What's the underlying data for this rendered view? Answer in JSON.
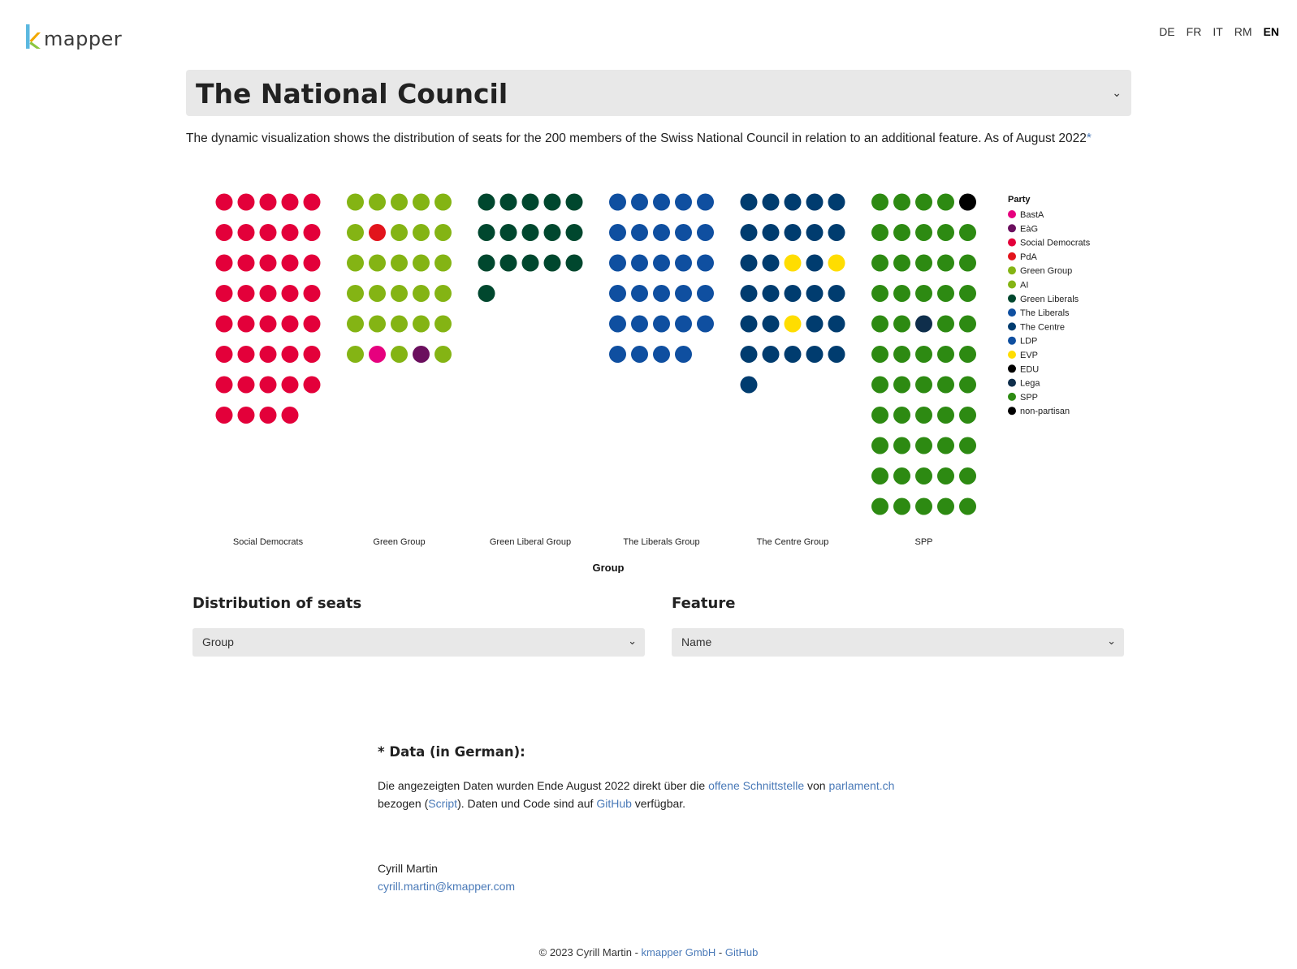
{
  "header": {
    "logo_text": "mapper",
    "languages": [
      "DE",
      "FR",
      "IT",
      "RM",
      "EN"
    ],
    "active_language": "EN"
  },
  "title_select": {
    "value": "The National Council"
  },
  "intro": {
    "text": "The dynamic visualization shows the distribution of seats for the 200 members of the Swiss National Council in relation to an additional feature. As of August 2022",
    "star": "*"
  },
  "chart_data": {
    "type": "dot_grid",
    "xlabel": "Group",
    "columns_per_group": 5,
    "groups": [
      {
        "name": "Social Democrats",
        "seats": [
          "Social Democrats",
          "Social Democrats",
          "Social Democrats",
          "Social Democrats",
          "Social Democrats",
          "Social Democrats",
          "Social Democrats",
          "Social Democrats",
          "Social Democrats",
          "Social Democrats",
          "Social Democrats",
          "Social Democrats",
          "Social Democrats",
          "Social Democrats",
          "Social Democrats",
          "Social Democrats",
          "Social Democrats",
          "Social Democrats",
          "Social Democrats",
          "Social Democrats",
          "Social Democrats",
          "Social Democrats",
          "Social Democrats",
          "Social Democrats",
          "Social Democrats",
          "Social Democrats",
          "Social Democrats",
          "Social Democrats",
          "Social Democrats",
          "Social Democrats",
          "Social Democrats",
          "Social Democrats",
          "Social Democrats",
          "Social Democrats",
          "Social Democrats",
          "Social Democrats",
          "Social Democrats",
          "Social Democrats",
          "Social Democrats"
        ]
      },
      {
        "name": "Green Group",
        "seats": [
          "Green Group",
          "Green Group",
          "Green Group",
          "Green Group",
          "Green Group",
          "Green Group",
          "PdA",
          "Green Group",
          "Green Group",
          "Green Group",
          "Green Group",
          "Green Group",
          "Green Group",
          "Green Group",
          "Green Group",
          "Green Group",
          "Green Group",
          "Green Group",
          "Green Group",
          "Green Group",
          "Green Group",
          "Green Group",
          "Green Group",
          "Green Group",
          "Green Group",
          "AI",
          "BastA",
          "AI",
          "EàG",
          "AI"
        ]
      },
      {
        "name": "Green Liberal Group",
        "seats": [
          "Green Liberals",
          "Green Liberals",
          "Green Liberals",
          "Green Liberals",
          "Green Liberals",
          "Green Liberals",
          "Green Liberals",
          "Green Liberals",
          "Green Liberals",
          "Green Liberals",
          "Green Liberals",
          "Green Liberals",
          "Green Liberals",
          "Green Liberals",
          "Green Liberals",
          "Green Liberals"
        ]
      },
      {
        "name": "The Liberals Group",
        "seats": [
          "The Liberals",
          "The Liberals",
          "The Liberals",
          "The Liberals",
          "The Liberals",
          "The Liberals",
          "The Liberals",
          "The Liberals",
          "The Liberals",
          "The Liberals",
          "The Liberals",
          "The Liberals",
          "The Liberals",
          "The Liberals",
          "The Liberals",
          "The Liberals",
          "The Liberals",
          "The Liberals",
          "The Liberals",
          "The Liberals",
          "The Liberals",
          "The Liberals",
          "The Liberals",
          "The Liberals",
          "The Liberals",
          "The Liberals",
          "The Liberals",
          "The Liberals",
          "The Liberals"
        ]
      },
      {
        "name": "The Centre Group",
        "seats": [
          "The Centre",
          "The Centre",
          "The Centre",
          "The Centre",
          "The Centre",
          "The Centre",
          "The Centre",
          "The Centre",
          "The Centre",
          "The Centre",
          "The Centre",
          "The Centre",
          "EVP",
          "The Centre",
          "EVP",
          "The Centre",
          "The Centre",
          "The Centre",
          "The Centre",
          "The Centre",
          "The Centre",
          "The Centre",
          "EVP",
          "The Centre",
          "The Centre",
          "The Centre",
          "The Centre",
          "The Centre",
          "The Centre",
          "The Centre",
          "The Centre"
        ]
      },
      {
        "name": "SPP",
        "seats": [
          "SPP",
          "SPP",
          "SPP",
          "SPP",
          "EDU",
          "SPP",
          "SPP",
          "SPP",
          "SPP",
          "SPP",
          "SPP",
          "SPP",
          "SPP",
          "SPP",
          "SPP",
          "SPP",
          "SPP",
          "SPP",
          "SPP",
          "SPP",
          "SPP",
          "SPP",
          "Lega",
          "SPP",
          "SPP",
          "SPP",
          "SPP",
          "SPP",
          "SPP",
          "SPP",
          "SPP",
          "SPP",
          "SPP",
          "SPP",
          "SPP",
          "SPP",
          "SPP",
          "SPP",
          "SPP",
          "SPP",
          "SPP",
          "SPP",
          "SPP",
          "SPP",
          "SPP",
          "SPP",
          "SPP",
          "SPP",
          "SPP",
          "SPP",
          "SPP",
          "SPP",
          "SPP",
          "SPP",
          "SPP"
        ]
      }
    ],
    "legend": {
      "title": "Party",
      "entries": [
        {
          "name": "BastA",
          "color": "#e6007e"
        },
        {
          "name": "EàG",
          "color": "#6b0f5e"
        },
        {
          "name": "Social Democrats",
          "color": "#e3003a"
        },
        {
          "name": "PdA",
          "color": "#e2141c"
        },
        {
          "name": "Green Group",
          "color": "#84b414"
        },
        {
          "name": "AI",
          "color": "#84b414"
        },
        {
          "name": "Green Liberals",
          "color": "#00472e"
        },
        {
          "name": "The Liberals",
          "color": "#0f4fa0"
        },
        {
          "name": "The Centre",
          "color": "#003c6f"
        },
        {
          "name": "LDP",
          "color": "#0f4fa0"
        },
        {
          "name": "EVP",
          "color": "#ffdd00"
        },
        {
          "name": "EDU",
          "color": "#000000"
        },
        {
          "name": "Lega",
          "color": "#0f2e4b"
        },
        {
          "name": "SPP",
          "color": "#2d8a12"
        },
        {
          "name": "non-partisan",
          "color": "#000000"
        }
      ]
    }
  },
  "controls": {
    "distribution_label": "Distribution of seats",
    "distribution_value": "Group",
    "feature_label": "Feature",
    "feature_value": "Name"
  },
  "footnote": {
    "heading": "* Data (in German):",
    "t1": "Die angezeigten Daten wurden Ende August 2022 direkt über die ",
    "link1": "offene Schnittstelle",
    "t2": " von ",
    "link2": "parlament.ch",
    "t3": "bezogen (",
    "link3": "Script",
    "t4": "). Daten und Code sind auf ",
    "link4": "GitHub",
    "t5": " verfügbar."
  },
  "author": {
    "name": "Cyrill Martin",
    "email": "cyrill.martin@kmapper.com"
  },
  "footer": {
    "copyright": "© 2023 Cyrill Martin - ",
    "company": "kmapper GmbH",
    "sep": " - ",
    "github": "GitHub"
  }
}
